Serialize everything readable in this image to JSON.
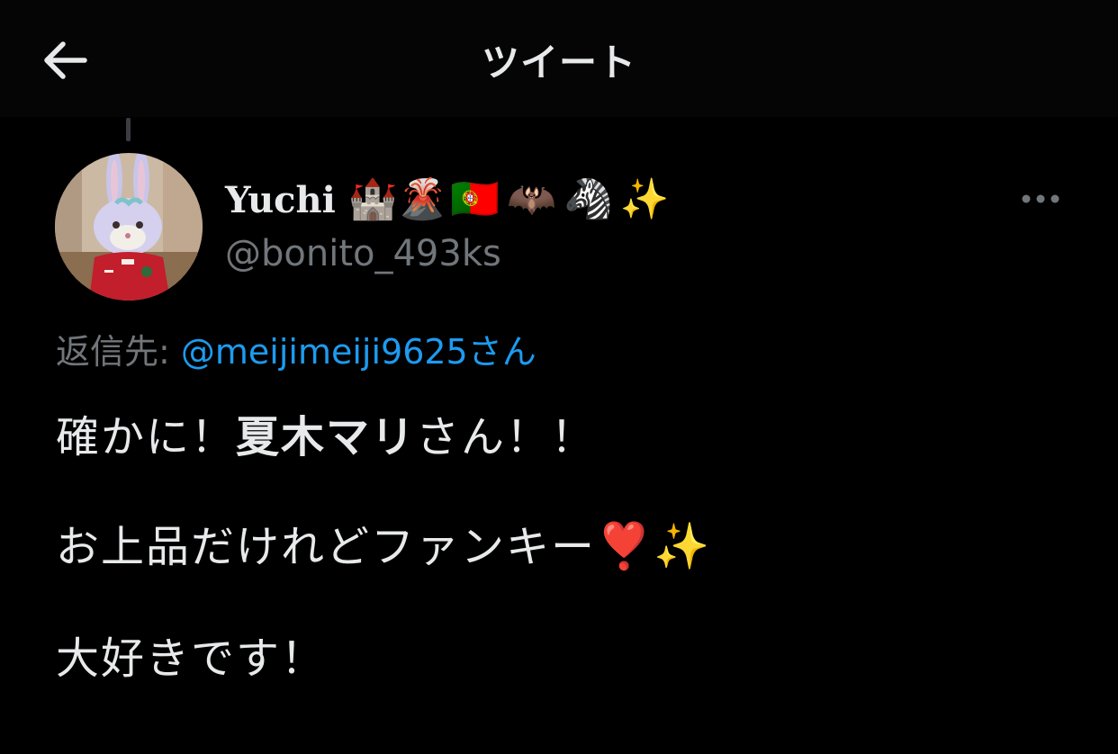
{
  "header": {
    "title": "ツイート"
  },
  "user": {
    "display_name": "Yuchi",
    "name_emojis": [
      "🏰",
      "🌋",
      "🇵🇹",
      "🦇",
      "🦓",
      "✨"
    ],
    "handle": "@bonito_493ks"
  },
  "reply": {
    "label": "返信先: ",
    "to_handle": "@meijimeiji9625さん"
  },
  "tweet": {
    "line1_prefix": "確かに！",
    "line1_bold": "夏木マリ",
    "line1_suffix": "さん！！",
    "line2_text": "お上品だけれどファンキー",
    "line2_emoji1": "❣️",
    "line2_emoji2": "✨",
    "line3_text": "大好きです！"
  },
  "icons": {
    "back": "back-arrow-icon",
    "more": "more-options-icon"
  },
  "colors": {
    "background": "#000000",
    "text": "#e7e9ea",
    "secondary": "#71767b",
    "link": "#1d9bf0"
  }
}
